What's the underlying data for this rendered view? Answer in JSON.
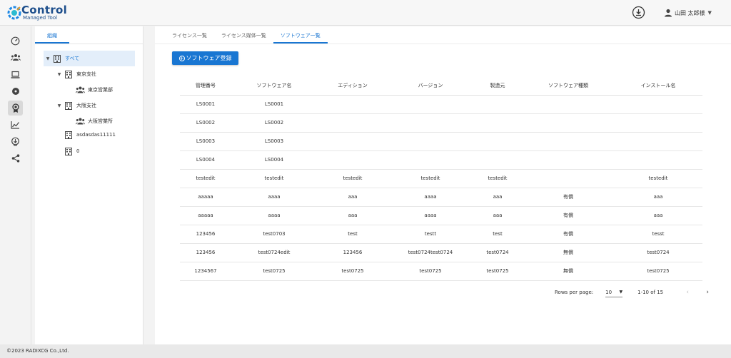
{
  "app": {
    "logo_title": "Control",
    "logo_subtitle": "Managed Tool"
  },
  "header": {
    "user_name": "山田 太郎様"
  },
  "rail": {
    "icons": [
      "dashboard-icon",
      "people-icon",
      "laptop-icon",
      "disc-icon",
      "license-icon",
      "chart-icon",
      "network-icon",
      "share-icon"
    ],
    "active_index": 4
  },
  "tree": {
    "tab_label": "組織",
    "nodes": [
      {
        "label": "すべて",
        "level": 0,
        "expanded": true,
        "type": "building",
        "selected": true
      },
      {
        "label": "東京支社",
        "level": 1,
        "expanded": true,
        "type": "building"
      },
      {
        "label": "東京営業部",
        "level": 2,
        "type": "group"
      },
      {
        "label": "大阪支社",
        "level": 1,
        "expanded": true,
        "type": "building"
      },
      {
        "label": "大阪営業所",
        "level": 2,
        "type": "group"
      },
      {
        "label": "asdasdas11111",
        "level": 1,
        "type": "building"
      },
      {
        "label": "0",
        "level": 1,
        "type": "building"
      }
    ]
  },
  "main": {
    "tabs": [
      {
        "label": "ライセンス一覧",
        "active": false
      },
      {
        "label": "ライセンス媒体一覧",
        "active": false
      },
      {
        "label": "ソフトウェア一覧",
        "active": true
      }
    ],
    "register_button": "ソフトウェア登録"
  },
  "table": {
    "columns": [
      "管理番号",
      "ソフトウェア名",
      "エディション",
      "バージョン",
      "製造元",
      "ソフトウェア種類",
      "インストール名"
    ],
    "rows": [
      [
        "LS0001",
        "LS0001",
        "",
        "",
        "",
        "",
        ""
      ],
      [
        "LS0002",
        "LS0002",
        "",
        "",
        "",
        "",
        ""
      ],
      [
        "LS0003",
        "LS0003",
        "",
        "",
        "",
        "",
        ""
      ],
      [
        "LS0004",
        "LS0004",
        "",
        "",
        "",
        "",
        ""
      ],
      [
        "testedit",
        "testedit",
        "testedit",
        "testedit",
        "testedit",
        "",
        "testedit"
      ],
      [
        "aaaaa",
        "aaaa",
        "aaa",
        "aaaa",
        "aaa",
        "有償",
        "aaa"
      ],
      [
        "aaaaa",
        "aaaa",
        "aaa",
        "aaaa",
        "aaa",
        "有償",
        "aaa"
      ],
      [
        "123456",
        "test0703",
        "test",
        "testt",
        "test",
        "有償",
        "tesst"
      ],
      [
        "123456",
        "test0724edit",
        "123456",
        "test0724test0724",
        "test0724",
        "無償",
        "test0724"
      ],
      [
        "1234567",
        "test0725",
        "test0725",
        "test0725",
        "test0725",
        "無償",
        "test0725"
      ]
    ]
  },
  "pagination": {
    "rows_per_page_label": "Rows per page:",
    "rows_per_page_value": "10",
    "range_text": "1-10 of 15"
  },
  "footer": {
    "copyright": "©2023 RADIXCG Co.,Ltd."
  },
  "colors": {
    "accent": "#1976d2",
    "logo": "#1e4f8c"
  }
}
